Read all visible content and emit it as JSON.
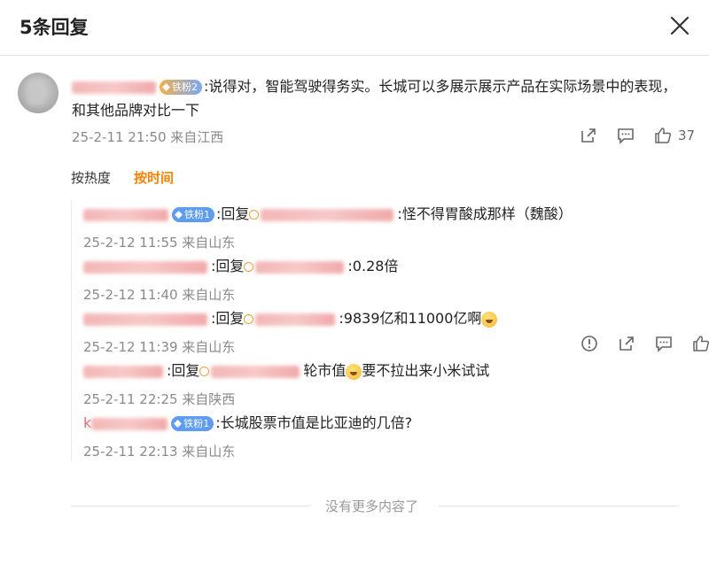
{
  "header": {
    "title": "5条回复"
  },
  "main_comment": {
    "badge": "铁粉2",
    "text": ":说得对，智能驾驶得务实。长城可以多展示展示产品在实际场景中的表现，和其他品牌对比一下",
    "meta": "25-2-11 21:50 来自江西",
    "likes": "37"
  },
  "sort": {
    "hot": "按热度",
    "time": "按时间"
  },
  "replies": [
    {
      "badge": "铁粉1",
      "prefix": ":回复",
      "text": ":怪不得胃酸成那样（魏酸）",
      "meta": "25-2-12 11:55 来自山东"
    },
    {
      "badge": "",
      "prefix": ":回复",
      "text": ":0.28倍",
      "meta": "25-2-12 11:40 来自山东"
    },
    {
      "badge": "",
      "prefix": ":回复",
      "text": ":9839亿和11000亿啊",
      "meta": "25-2-12 11:39 来自山东"
    },
    {
      "badge": "",
      "prefix": ":回复",
      "text_a": "轮市值",
      "text_b": "要不拉出来小米试试",
      "meta": "25-2-11 22:25 来自陕西"
    },
    {
      "badge": "铁粉1",
      "user_initial": "k",
      "text": ":长城股票市值是比亚迪的几倍?",
      "meta": "25-2-11 22:13 来自山东"
    }
  ],
  "footer": {
    "text": "没有更多内容了"
  }
}
